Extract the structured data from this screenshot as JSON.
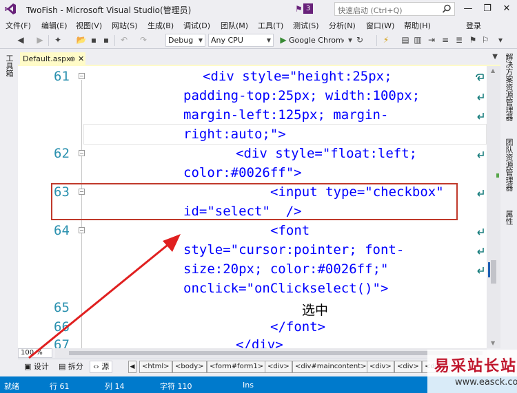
{
  "window": {
    "title": "TwoFish - Microsoft Visual Studio(管理员)",
    "notification_count": "3",
    "quick_launch_placeholder": "快速启动 (Ctrl+Q)",
    "minimize": "—",
    "restore": "❐",
    "close": "✕"
  },
  "menu": {
    "items": [
      "文件(F)",
      "编辑(E)",
      "视图(V)",
      "网站(S)",
      "生成(B)",
      "调试(D)",
      "团队(M)",
      "工具(T)",
      "测试(S)",
      "分析(N)",
      "窗口(W)",
      "帮助(H)"
    ],
    "login": "登录"
  },
  "toolbar": {
    "config": "Debug",
    "platform": "Any CPU",
    "run_label": "Google Chrome"
  },
  "left_rail": {
    "toolbox": "工具箱"
  },
  "right_rail": {
    "solution_explorer": "解决方案资源管理器",
    "team_explorer": "团队资源管理器",
    "properties": "属性"
  },
  "tabs": {
    "active": "Default.aspx",
    "pin": "⊕",
    "close": "✕"
  },
  "editor": {
    "lines": [
      {
        "num": "61",
        "text": "<div style=\"height:25px;"
      },
      {
        "num": "",
        "text": "padding-top:25px; width:100px;"
      },
      {
        "num": "",
        "text": "margin-left:125px; margin-"
      },
      {
        "num": "",
        "text": "right:auto;\">"
      },
      {
        "num": "62",
        "text": "<div style=\"float:left;"
      },
      {
        "num": "",
        "text": "color:#0026ff\">"
      },
      {
        "num": "63",
        "text": "<input type=\"checkbox\""
      },
      {
        "num": "",
        "text": "id=\"select\"  />"
      },
      {
        "num": "64",
        "text": "<font"
      },
      {
        "num": "",
        "text": "style=\"cursor:pointer; font-"
      },
      {
        "num": "",
        "text": "size:20px; color:#0026ff;\""
      },
      {
        "num": "",
        "text": "onclick=\"onClickselect()\">"
      },
      {
        "num": "65",
        "text": "选中"
      },
      {
        "num": "66",
        "text": "</font>"
      },
      {
        "num": "67",
        "text": "</div>"
      }
    ]
  },
  "zoom": "100 %",
  "viewbar": {
    "design": "设计",
    "split": "拆分",
    "source": "源",
    "breadcrumbs": [
      "<html>",
      "<body>",
      "<form#form1>",
      "<div>",
      "<div#maincontent>",
      "<div>",
      "<div>",
      "<div>"
    ]
  },
  "status": {
    "ready": "就绪",
    "line": "行 61",
    "col": "列 14",
    "char": "字符 110",
    "mode": "Ins"
  },
  "watermark": {
    "name": "易采站长站",
    "url": "www.easck.com"
  },
  "colors": {
    "accent": "#007acc",
    "tag": "#800000",
    "attr": "#ff0000",
    "value": "#0000ff",
    "highlight": "#c0392b"
  }
}
